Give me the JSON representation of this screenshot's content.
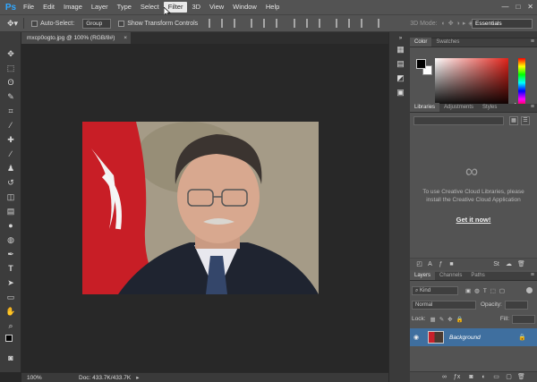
{
  "app": {
    "logo": "Ps"
  },
  "menu": [
    "File",
    "Edit",
    "Image",
    "Layer",
    "Type",
    "Select",
    "Filter",
    "3D",
    "View",
    "Window",
    "Help"
  ],
  "menu_active": "Filter",
  "window_controls": [
    "—",
    "□",
    "✕"
  ],
  "options": {
    "auto_select_label": "Auto-Select:",
    "auto_select_value": "Group",
    "transform_label": "Show Transform Controls",
    "mode_label": "3D Mode:",
    "workspace": "Essentials"
  },
  "document": {
    "tab_title": "mxcp0ogto.jpg @ 100% (RGB/8#)"
  },
  "status": {
    "zoom": "100%",
    "doc": "Doc: 433.7K/433.7K"
  },
  "panels": {
    "color_tabs": [
      "Color",
      "Swatches"
    ],
    "library_tabs": [
      "Libraries",
      "Adjustments",
      "Styles"
    ],
    "library_message": "To use Creative Cloud Libraries, please install the Creative Cloud Application",
    "library_link": "Get it now!",
    "layer_tabs": [
      "Layers",
      "Channels",
      "Paths"
    ],
    "kind_label": "Kind",
    "blend_mode": "Normal",
    "opacity_label": "Opacity:",
    "lock_label": "Lock:",
    "fill_label": "Fill:",
    "layer_name": "Background"
  }
}
